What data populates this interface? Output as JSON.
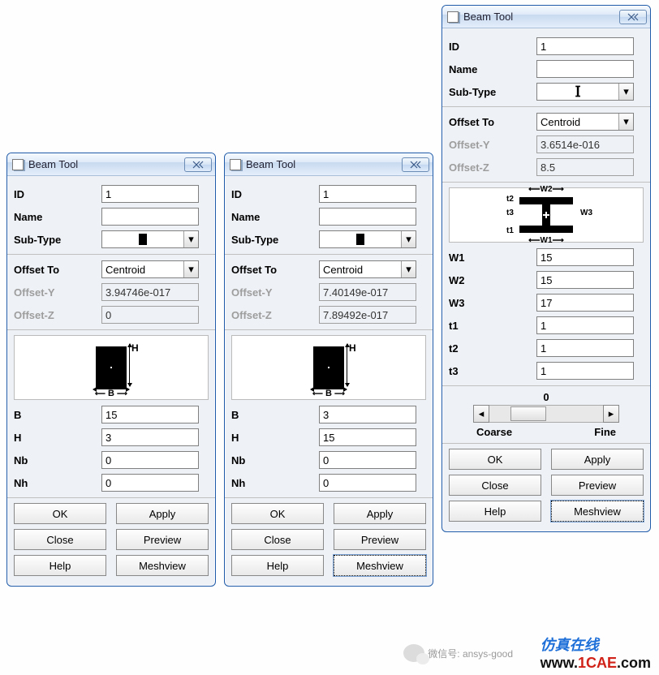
{
  "dialogs": [
    {
      "title": "Beam Tool",
      "id_label": "ID",
      "id_value": "1",
      "name_label": "Name",
      "name_value": "",
      "subtype_label": "Sub-Type",
      "subtype_shape": "rect",
      "offset_to_label": "Offset To",
      "offset_to_value": "Centroid",
      "offset_y_label": "Offset-Y",
      "offset_y_value": "3.94746e-017",
      "offset_z_label": "Offset-Z",
      "offset_z_value": "0",
      "diagram_h": "H",
      "diagram_b": "B",
      "params": [
        {
          "label": "B",
          "value": "15"
        },
        {
          "label": "H",
          "value": "3"
        },
        {
          "label": "Nb",
          "value": "0"
        },
        {
          "label": "Nh",
          "value": "0"
        }
      ],
      "buttons": {
        "ok": "OK",
        "apply": "Apply",
        "close": "Close",
        "preview": "Preview",
        "help": "Help",
        "meshview": "Meshview"
      }
    },
    {
      "title": "Beam Tool",
      "id_label": "ID",
      "id_value": "1",
      "name_label": "Name",
      "name_value": "",
      "subtype_label": "Sub-Type",
      "subtype_shape": "rect",
      "offset_to_label": "Offset To",
      "offset_to_value": "Centroid",
      "offset_y_label": "Offset-Y",
      "offset_y_value": "7.40149e-017",
      "offset_z_label": "Offset-Z",
      "offset_z_value": "7.89492e-017",
      "diagram_h": "H",
      "diagram_b": "B",
      "params": [
        {
          "label": "B",
          "value": "3"
        },
        {
          "label": "H",
          "value": "15"
        },
        {
          "label": "Nb",
          "value": "0"
        },
        {
          "label": "Nh",
          "value": "0"
        }
      ],
      "buttons": {
        "ok": "OK",
        "apply": "Apply",
        "close": "Close",
        "preview": "Preview",
        "help": "Help",
        "meshview": "Meshview"
      }
    },
    {
      "title": "Beam Tool",
      "id_label": "ID",
      "id_value": "1",
      "name_label": "Name",
      "name_value": "",
      "subtype_label": "Sub-Type",
      "subtype_shape": "ibeam",
      "offset_to_label": "Offset To",
      "offset_to_value": "Centroid",
      "offset_y_label": "Offset-Y",
      "offset_y_value": "3.6514e-016",
      "offset_z_label": "Offset-Z",
      "offset_z_value": "8.5",
      "ibeam_labels": {
        "t1": "t1",
        "t2": "t2",
        "t3": "t3",
        "w1": "W1",
        "w2": "W2",
        "w3": "W3"
      },
      "params": [
        {
          "label": "W1",
          "value": "15"
        },
        {
          "label": "W2",
          "value": "15"
        },
        {
          "label": "W3",
          "value": "17"
        },
        {
          "label": "t1",
          "value": "1"
        },
        {
          "label": "t2",
          "value": "1"
        },
        {
          "label": "t3",
          "value": "1"
        }
      ],
      "slider": {
        "value": "0",
        "coarse": "Coarse",
        "fine": "Fine"
      },
      "buttons": {
        "ok": "OK",
        "apply": "Apply",
        "close": "Close",
        "preview": "Preview",
        "help": "Help",
        "meshview": "Meshview"
      }
    }
  ],
  "watermark": {
    "wechat": "微信号: ansys-good",
    "cn_text": "仿真在线",
    "domain_www": "www.",
    "domain_1cae": "1CAE",
    "domain_com": ".com"
  }
}
